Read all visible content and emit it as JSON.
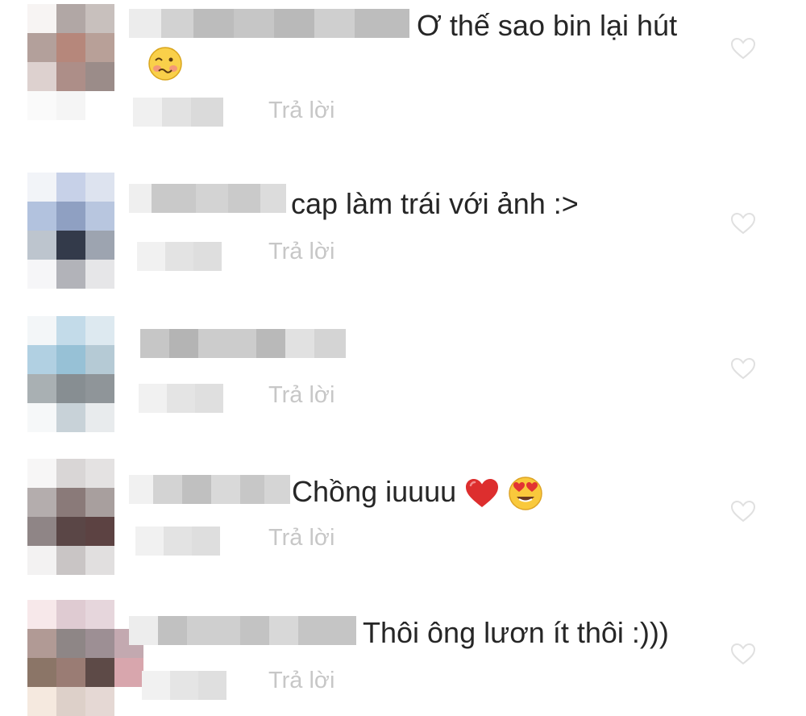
{
  "comments": [
    {
      "text": "Ơ thế sao bin lại hút",
      "emoji": "woozy-face",
      "reply_label": "Trả lời"
    },
    {
      "text": "cap làm trái với ảnh :>",
      "reply_label": "Trả lời"
    },
    {
      "text": "",
      "reply_label": "Trả lời"
    },
    {
      "text": "Chồng iuuuu",
      "emoji": [
        "red-heart",
        "heart-eyes-face"
      ],
      "reply_label": "Trả lời"
    },
    {
      "text": "Thôi ông lươn ít thôi :)))",
      "reply_label": "Trả lời"
    }
  ],
  "colors": {
    "text": "#262626",
    "reply": "#c7c7c7",
    "heart_outline": "#e0e0e0"
  }
}
